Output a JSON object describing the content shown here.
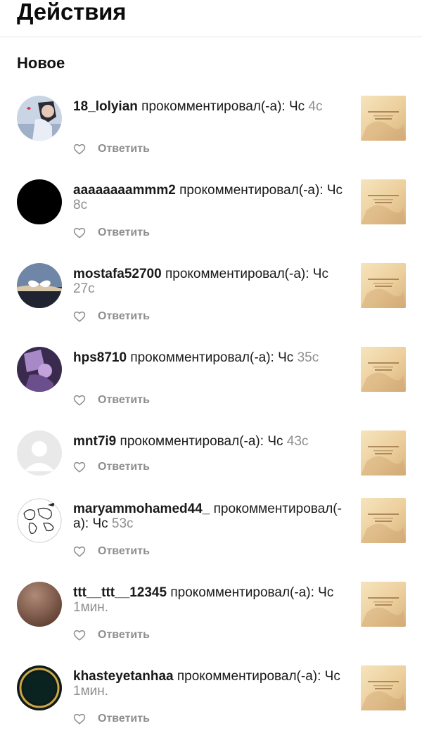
{
  "page": {
    "title": "Действия"
  },
  "section": {
    "title": "Новое"
  },
  "actions": {
    "reply_label": "Ответить"
  },
  "icons": {
    "like": "heart-outline-icon"
  },
  "colors": {
    "text": "#111111",
    "muted": "#8e8e8e",
    "divider": "#e4e4e4",
    "thumb": "#f2dcb0"
  },
  "notifications": [
    {
      "username": "18_lolyian",
      "action": " прокомментировал(-а): ",
      "comment": "Чс",
      "time": " 4с"
    },
    {
      "username": "aaaaaaaammm2",
      "action": " прокомментировал(-а): ",
      "comment": "Чс",
      "time": " 8с"
    },
    {
      "username": "mostafa52700",
      "action": " прокомментировал(-а): ",
      "comment": "Чс",
      "time": " 27с"
    },
    {
      "username": "hps8710",
      "action": " прокомментировал(-а): ",
      "comment": "Чс",
      "time": " 35с"
    },
    {
      "username": "mnt7i9",
      "action": " прокомментировал(-а): ",
      "comment": "Чс",
      "time": " 43с"
    },
    {
      "username": "maryammohamed44_",
      "action": " прокомментировал(-а): ",
      "comment": "Чс",
      "time": " 53с"
    },
    {
      "username": "ttt__ttt__12345",
      "action": " прокомментировал(-а): ",
      "comment": "Чс",
      "time": " 1мин."
    },
    {
      "username": "khasteyetanhaa",
      "action": " прокомментировал(-а): ",
      "comment": "Чс",
      "time": " 1мин."
    }
  ]
}
